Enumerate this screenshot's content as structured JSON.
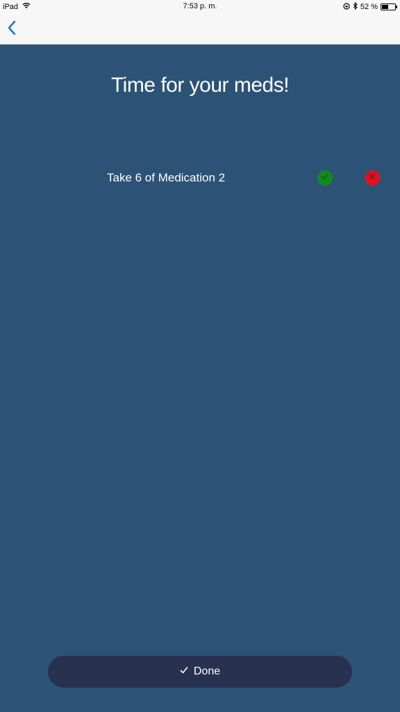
{
  "status_bar": {
    "device": "iPad",
    "time": "7:53 p. m.",
    "battery_text": "52 %",
    "battery_level": 0.52
  },
  "nav": {
    "back_icon": "chevron-left-icon",
    "accent_color": "#1a73d9"
  },
  "main": {
    "title": "Time for your meds!",
    "medications": [
      {
        "label": "Take 6 of Medication 2",
        "accept_icon": "check-circle-icon",
        "reject_icon": "x-circle-icon"
      }
    ],
    "background_color": "#2c5375"
  },
  "footer": {
    "done_label": "Done",
    "done_icon": "checkmark-icon",
    "done_color": "#283250"
  }
}
